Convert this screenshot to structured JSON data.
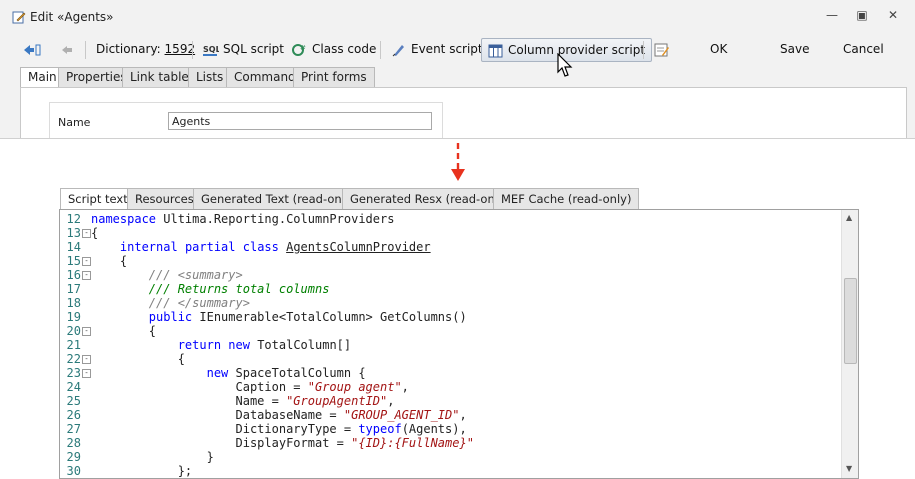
{
  "window": {
    "title": "Edit «Agents»",
    "controls": [
      "minimize",
      "restore",
      "close"
    ]
  },
  "toolbar": {
    "dictionary_label": "Dictionary:",
    "dictionary_value": "1592",
    "sql_script": "SQL script",
    "class_code": "Class code",
    "event_script": "Event script",
    "column_provider_script": "Column provider script",
    "ok": "OK",
    "save": "Save",
    "cancel": "Cancel"
  },
  "top_tabs": [
    "Main",
    "Properties",
    "Link tables",
    "Lists",
    "Commands",
    "Print forms"
  ],
  "form": {
    "name_label": "Name",
    "name_value": "Agents"
  },
  "editor_tabs": [
    "Script text",
    "Resources",
    "Generated Text (read-only)",
    "Generated Resx (read-only)",
    "MEF Cache (read-only)"
  ],
  "code_lines": [
    {
      "n": "12",
      "fold": ""
    },
    {
      "n": "13",
      "fold": "-"
    },
    {
      "n": "14",
      "fold": ""
    },
    {
      "n": "15",
      "fold": "-"
    },
    {
      "n": "16",
      "fold": "-"
    },
    {
      "n": "17",
      "fold": ""
    },
    {
      "n": "18",
      "fold": ""
    },
    {
      "n": "19",
      "fold": ""
    },
    {
      "n": "20",
      "fold": "-"
    },
    {
      "n": "21",
      "fold": ""
    },
    {
      "n": "22",
      "fold": "-"
    },
    {
      "n": "23",
      "fold": "-"
    },
    {
      "n": "24",
      "fold": ""
    },
    {
      "n": "25",
      "fold": ""
    },
    {
      "n": "26",
      "fold": ""
    },
    {
      "n": "27",
      "fold": ""
    },
    {
      "n": "28",
      "fold": ""
    },
    {
      "n": "29",
      "fold": ""
    },
    {
      "n": "30",
      "fold": ""
    }
  ],
  "code": {
    "l12a": "namespace",
    "l12b": " Ultima.Reporting.ColumnProviders",
    "l13": "{",
    "l14a": "internal",
    "l14b": "partial",
    "l14c": "class",
    "l14d": "AgentsColumnProvider",
    "l15": "{",
    "l16a": "///",
    "l16b": " <summary>",
    "l17": "/// Returns total columns",
    "l18a": "///",
    "l18b": " </summary>",
    "l19a": "public",
    "l19b": " IEnumerable<TotalColumn> GetColumns()",
    "l20": "{",
    "l21a": "return",
    "l21b": "new",
    "l21c": " TotalColumn[]",
    "l22": "{",
    "l23a": "new",
    "l23b": " SpaceTotalColumn {",
    "l24a": "Caption = ",
    "l24b": "\"Group agent\"",
    "l24c": ",",
    "l25a": "Name = ",
    "l25b": "\"GroupAgentID\"",
    "l25c": ",",
    "l26a": "DatabaseName = ",
    "l26b": "\"GROUP_AGENT_ID\"",
    "l26c": ",",
    "l27a": "DictionaryType = ",
    "l27b": "typeof",
    "l27c": "(Agents),",
    "l28a": "DisplayFormat = ",
    "l28b": "\"{ID}:{FullName}\"",
    "l29": "}",
    "l30": "};"
  },
  "colors": {
    "keyword": "#0000ff",
    "comment": "#008000",
    "string": "#a31515",
    "line_number": "#2b7a7a",
    "arrow": "#e8321e"
  }
}
